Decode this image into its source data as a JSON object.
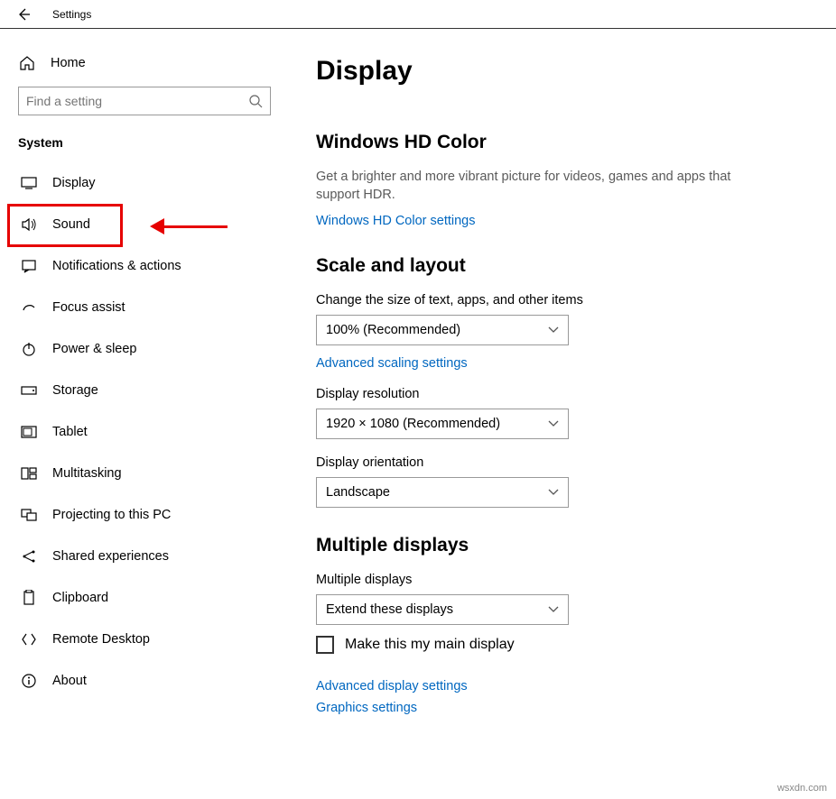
{
  "titlebar": {
    "title": "Settings"
  },
  "sidebar": {
    "home": "Home",
    "search_placeholder": "Find a setting",
    "section": "System",
    "items": [
      {
        "label": "Display"
      },
      {
        "label": "Sound"
      },
      {
        "label": "Notifications & actions"
      },
      {
        "label": "Focus assist"
      },
      {
        "label": "Power & sleep"
      },
      {
        "label": "Storage"
      },
      {
        "label": "Tablet"
      },
      {
        "label": "Multitasking"
      },
      {
        "label": "Projecting to this PC"
      },
      {
        "label": "Shared experiences"
      },
      {
        "label": "Clipboard"
      },
      {
        "label": "Remote Desktop"
      },
      {
        "label": "About"
      }
    ]
  },
  "main": {
    "title": "Display",
    "hdr": {
      "heading": "Windows HD Color",
      "desc": "Get a brighter and more vibrant picture for videos, games and apps that support HDR.",
      "link": "Windows HD Color settings"
    },
    "scale": {
      "heading": "Scale and layout",
      "size_label": "Change the size of text, apps, and other items",
      "size_value": "100% (Recommended)",
      "adv_link": "Advanced scaling settings",
      "res_label": "Display resolution",
      "res_value": "1920 × 1080 (Recommended)",
      "orient_label": "Display orientation",
      "orient_value": "Landscape"
    },
    "multi": {
      "heading": "Multiple displays",
      "label": "Multiple displays",
      "value": "Extend these displays",
      "checkbox": "Make this my main display",
      "adv_link": "Advanced display settings",
      "gfx_link": "Graphics settings"
    }
  },
  "watermark": "wsxdn.com"
}
